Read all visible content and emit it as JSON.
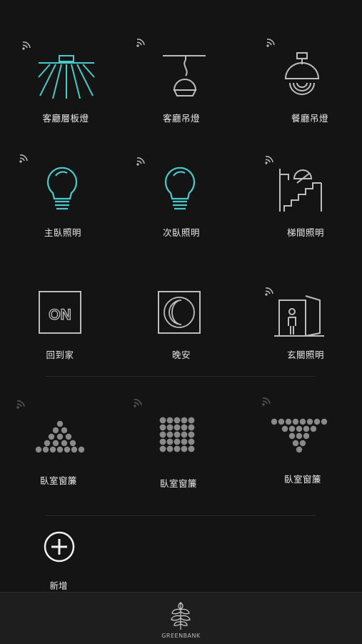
{
  "colors": {
    "background": "#141414",
    "accent": "#49c9c9",
    "icon_gray": "#8a8a8a",
    "icon_light": "#bdbdbd"
  },
  "devices": [
    {
      "label": "客廳層板燈",
      "icon": "ceiling-panel-light-icon",
      "wifi": true
    },
    {
      "label": "客廳吊燈",
      "icon": "pendant-lamp-icon",
      "wifi": true
    },
    {
      "label": "餐廳吊燈",
      "icon": "dome-pendant-lamp-icon",
      "wifi": true
    },
    {
      "label": "主臥照明",
      "icon": "light-bulb-icon",
      "wifi": true
    },
    {
      "label": "次臥照明",
      "icon": "light-bulb-icon",
      "wifi": true
    },
    {
      "label": "梯間照明",
      "icon": "stair-lamp-icon",
      "wifi": true
    }
  ],
  "scenes": [
    {
      "label": "回到家",
      "icon": "on-scene-icon",
      "icon_text": "ON"
    },
    {
      "label": "晚安",
      "icon": "moon-scene-icon"
    },
    {
      "label": "玄關照明",
      "icon": "entrance-door-icon",
      "wifi": true
    }
  ],
  "curtains": [
    {
      "label": "臥室窗簾",
      "icon": "curtain-triangle-icon",
      "wifi": true
    },
    {
      "label": "臥室窗簾",
      "icon": "curtain-grid-icon",
      "wifi": true
    },
    {
      "label": "臥室窗簾",
      "icon": "curtain-inverted-triangle-icon",
      "wifi": true
    }
  ],
  "add": {
    "label": "新增",
    "icon": "plus-circle-icon"
  },
  "footer": {
    "brand": "GREENBANK",
    "icon": "greenbank-logo-icon"
  }
}
